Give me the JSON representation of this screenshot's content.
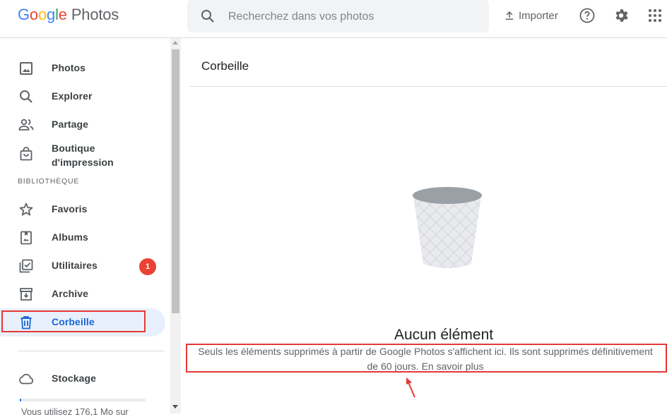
{
  "app": {
    "logo_brand": [
      "G",
      "o",
      "o",
      "g",
      "l",
      "e"
    ],
    "logo_product": "Photos"
  },
  "search": {
    "placeholder": "Recherchez dans vos photos",
    "value": ""
  },
  "header": {
    "import_label": "Importer",
    "icons": [
      "upload-icon",
      "help-icon",
      "settings-icon",
      "apps-grid-icon"
    ]
  },
  "sidebar": {
    "items_top": [
      {
        "label": "Photos",
        "icon": "photo-icon"
      },
      {
        "label": "Explorer",
        "icon": "search-icon"
      },
      {
        "label": "Partage",
        "icon": "people-icon"
      },
      {
        "label": "Boutique\nd'impression",
        "icon": "shopping-bag-icon"
      }
    ],
    "library_heading": "BIBLIOTHÈQUE",
    "items_library": [
      {
        "label": "Favoris",
        "icon": "star-icon"
      },
      {
        "label": "Albums",
        "icon": "album-icon"
      },
      {
        "label": "Utilitaires",
        "icon": "utilities-icon",
        "badge": "1"
      },
      {
        "label": "Archive",
        "icon": "archive-icon"
      },
      {
        "label": "Corbeille",
        "icon": "trash-icon",
        "active": true
      }
    ],
    "storage": {
      "label": "Stockage",
      "icon": "cloud-icon",
      "used_fraction": 0.01,
      "text": "Vous utilisez 176,1 Mo sur"
    }
  },
  "main": {
    "title": "Corbeille",
    "empty_title": "Aucun élément",
    "empty_desc": "Seuls les éléments supprimés à partir de Google Photos s'affichent ici. Ils sont supprimés définitivement",
    "empty_desc_2": "de 60 jours.",
    "learn_more": "En savoir plus"
  },
  "colors": {
    "accent": "#1a73e8",
    "active_bg": "#e8f0fe",
    "badge": "#ea4335",
    "annotation": "#e53935"
  }
}
